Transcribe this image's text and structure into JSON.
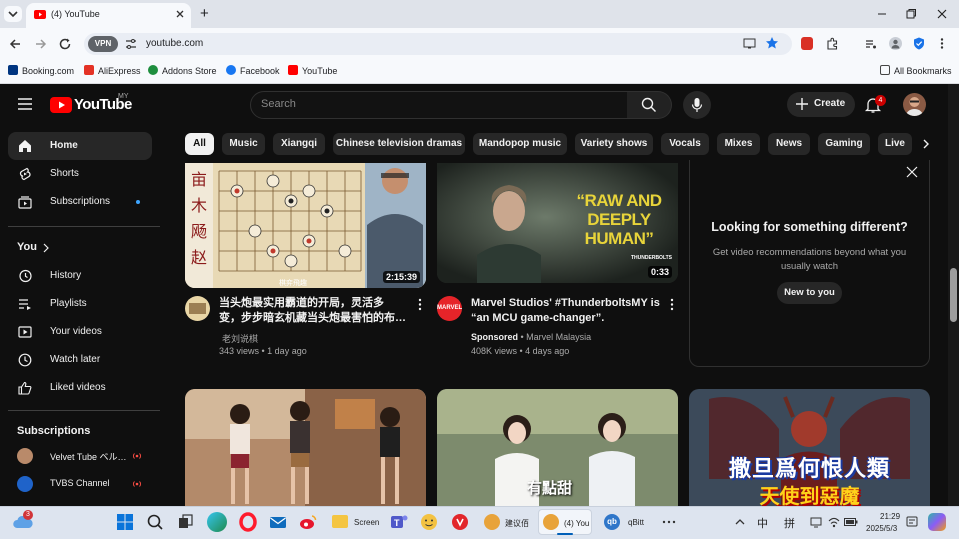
{
  "browser": {
    "tab_title": "(4) YouTube",
    "new_tab": "+",
    "url": "youtube.com",
    "vpn_label": "VPN",
    "bookmarks": [
      "Booking.com",
      "AliExpress",
      "Addons Store",
      "Facebook",
      "YouTube"
    ],
    "all_bookmarks": "All Bookmarks"
  },
  "youtube": {
    "logo_text": "YouTube",
    "region": "MY",
    "search_placeholder": "Search",
    "create_label": "Create",
    "notif_count": "4",
    "sidebar": {
      "main": [
        "Home",
        "Shorts",
        "Subscriptions"
      ],
      "you_heading": "You",
      "you_items": [
        "History",
        "Playlists",
        "Your videos",
        "Watch later",
        "Liked videos"
      ],
      "subs_heading": "Subscriptions",
      "subs": [
        "Velvet Tube ベル…",
        "TVBS Channel"
      ]
    },
    "chips": [
      "All",
      "Music",
      "Xiangqi",
      "Chinese television dramas",
      "Mandopop music",
      "Variety shows",
      "Vocals",
      "Mixes",
      "News",
      "Gaming",
      "Live"
    ],
    "videos": [
      {
        "title_line1": "当头炮最实用霸道的开局，灵活多",
        "title_line2": "变，步步暗玄机藏当头炮最害怕的布…",
        "channel": "老刘说棋",
        "meta": "343 views • 1 day ago",
        "duration": "2:15:39",
        "thumb_text": "棋弈飛趣"
      },
      {
        "title_line1": "Marvel Studios' #ThunderboltsMY is",
        "title_line2": "“an MCU game-changer”.",
        "sponsored": "Sponsored",
        "channel": "Marvel Malaysia",
        "meta": "408K views • 4 days ago",
        "duration": "0:33",
        "thumb_text1": "“RAW AND",
        "thumb_text2": "DEEPLY",
        "thumb_text3": "HUMAN”",
        "thumb_brand": "THUNDERBOLTS",
        "avatar_text": "MARVEL"
      }
    ],
    "feedback": {
      "title": "Looking for something different?",
      "body1": "Get video recommendations beyond what you",
      "body2": "usually watch",
      "button": "New to you"
    },
    "row2": [
      {
        "thumb_text": ""
      },
      {
        "thumb_text": "有點甜"
      },
      {
        "thumb_text1": "撒旦爲何恨人類",
        "thumb_text2": "天使到惡魔"
      }
    ]
  },
  "taskbar": {
    "weather_badge": "3",
    "apps": [
      "Screen",
      "建议佰",
      "(4) You",
      "qBitt"
    ],
    "ime1": "中",
    "ime2": "拼",
    "time": "21:29",
    "date": "2025/5/3"
  }
}
